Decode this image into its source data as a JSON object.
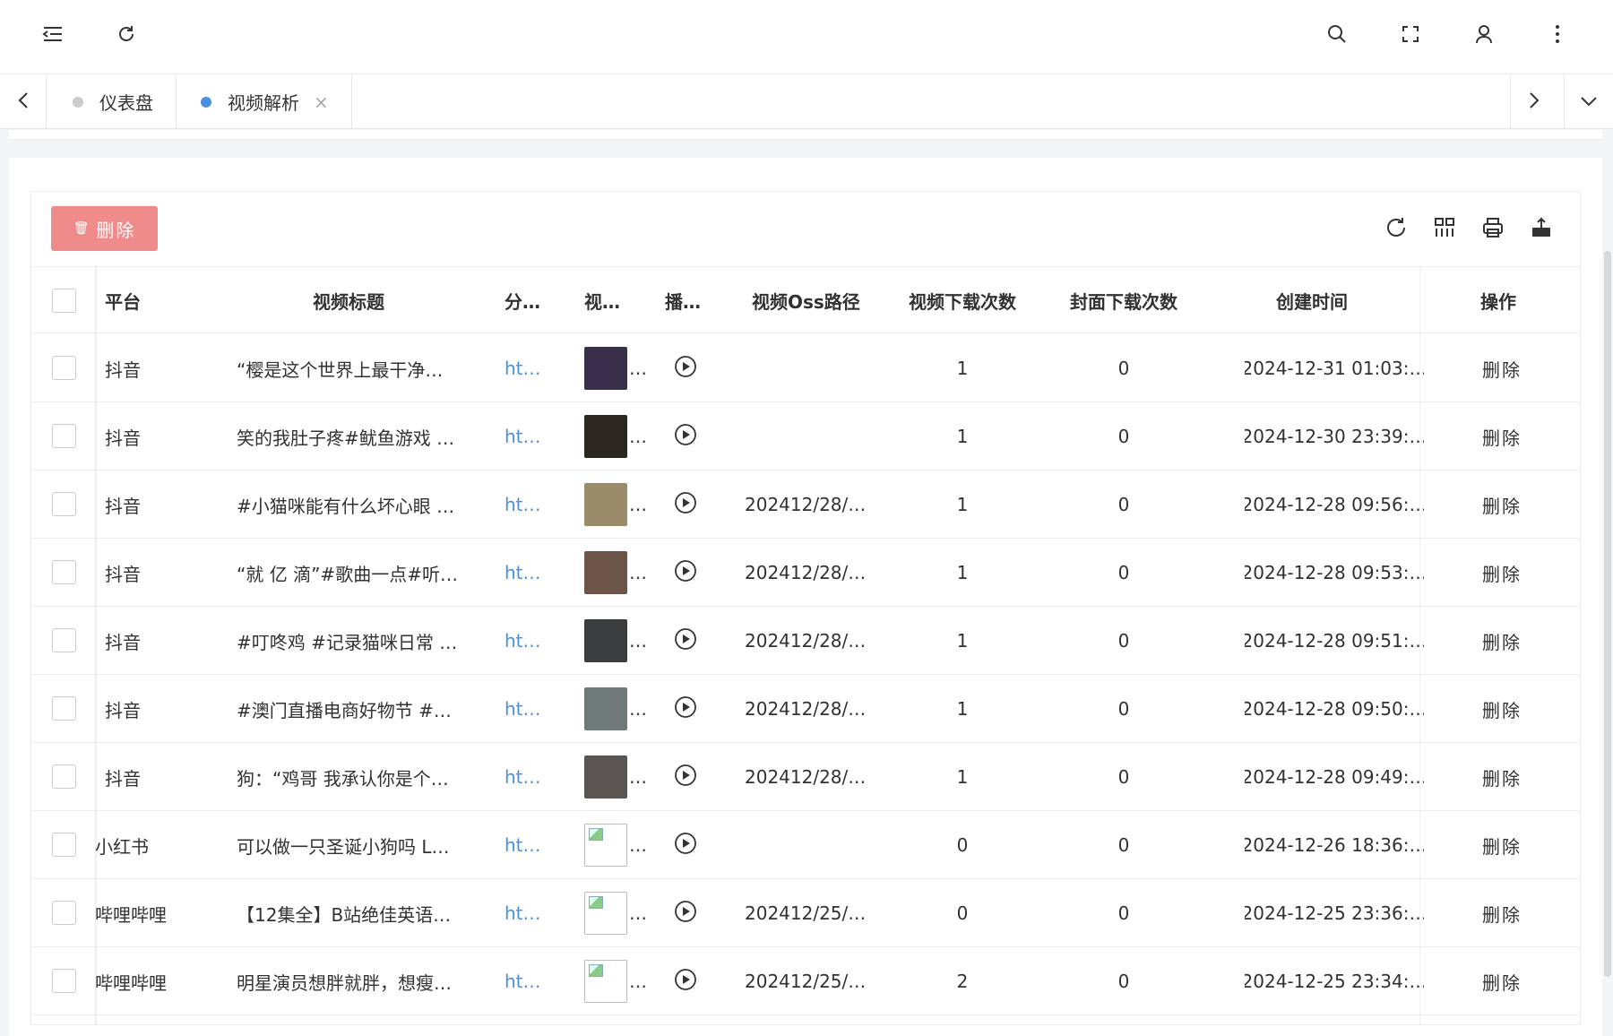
{
  "tabs": [
    {
      "label": "仪表盘",
      "dot_color": "#cccccc"
    },
    {
      "label": "视频解析",
      "dot_color": "#4a90e2",
      "close": "×"
    }
  ],
  "toolbar": {
    "delete_label": "删除",
    "delete_icon": "trash-icon"
  },
  "columns": [
    "平台",
    "视频标题",
    "分…",
    "视…",
    "播…",
    "视频Oss路径",
    "视频下载次数",
    "封面下载次数",
    "创建时间",
    "操作"
  ],
  "rows": [
    {
      "platform": "抖音",
      "title": "“樱是这个世界上最干净…",
      "share": "ht…",
      "thumb_color": "#3a2f4a",
      "oss": "",
      "video_dl": "1",
      "cover_dl": "0",
      "created": "2024-12-31 01:03:…",
      "action": "删除"
    },
    {
      "platform": "抖音",
      "title": "笑的我肚子疼#鱿鱼游戏 …",
      "share": "ht…",
      "thumb_color": "#2a2620",
      "oss": "",
      "video_dl": "1",
      "cover_dl": "0",
      "created": "2024-12-30 23:39:…",
      "action": "删除"
    },
    {
      "platform": "抖音",
      "title": "#小猫咪能有什么坏心眼 …",
      "share": "ht…",
      "thumb_color": "#9a8c6a",
      "oss": "202412/28/…",
      "video_dl": "1",
      "cover_dl": "0",
      "created": "2024-12-28 09:56:…",
      "action": "删除"
    },
    {
      "platform": "抖音",
      "title": "“就 亿 滴”#歌曲一点#听…",
      "share": "ht…",
      "thumb_color": "#6a5548",
      "oss": "202412/28/…",
      "video_dl": "1",
      "cover_dl": "0",
      "created": "2024-12-28 09:53:…",
      "action": "删除"
    },
    {
      "platform": "抖音",
      "title": "#叮咚鸡 #记录猫咪日常 …",
      "share": "ht…",
      "thumb_color": "#3a3c3e",
      "oss": "202412/28/…",
      "video_dl": "1",
      "cover_dl": "0",
      "created": "2024-12-28 09:51:…",
      "action": "删除"
    },
    {
      "platform": "抖音",
      "title": "#澳门直播电商好物节 #…",
      "share": "ht…",
      "thumb_color": "#6f7a78",
      "oss": "202412/28/…",
      "video_dl": "1",
      "cover_dl": "0",
      "created": "2024-12-28 09:50:…",
      "action": "删除"
    },
    {
      "platform": "抖音",
      "title": "狗：“鸡哥 我承认你是个…",
      "share": "ht…",
      "thumb_color": "#5a5550",
      "oss": "202412/28/…",
      "video_dl": "1",
      "cover_dl": "0",
      "created": "2024-12-28 09:49:…",
      "action": "删除"
    },
    {
      "platform": "小红书",
      "title": "可以做一只圣诞小狗吗 L…",
      "share": "ht…",
      "thumb_color": "broken",
      "oss": "",
      "video_dl": "0",
      "cover_dl": "0",
      "created": "2024-12-26 18:36:…",
      "action": "删除"
    },
    {
      "platform": "哔哩哔哩",
      "title": "【12集全】B站绝佳英语…",
      "share": "ht…",
      "thumb_color": "broken",
      "oss": "202412/25/…",
      "video_dl": "0",
      "cover_dl": "0",
      "created": "2024-12-25 23:36:…",
      "action": "删除"
    },
    {
      "platform": "哔哩哔哩",
      "title": "明星演员想胖就胖，想瘦…",
      "share": "ht…",
      "thumb_color": "broken",
      "oss": "202412/25/…",
      "video_dl": "2",
      "cover_dl": "0",
      "created": "2024-12-25 23:34:…",
      "action": "删除"
    }
  ],
  "thumb_suffix": "…"
}
